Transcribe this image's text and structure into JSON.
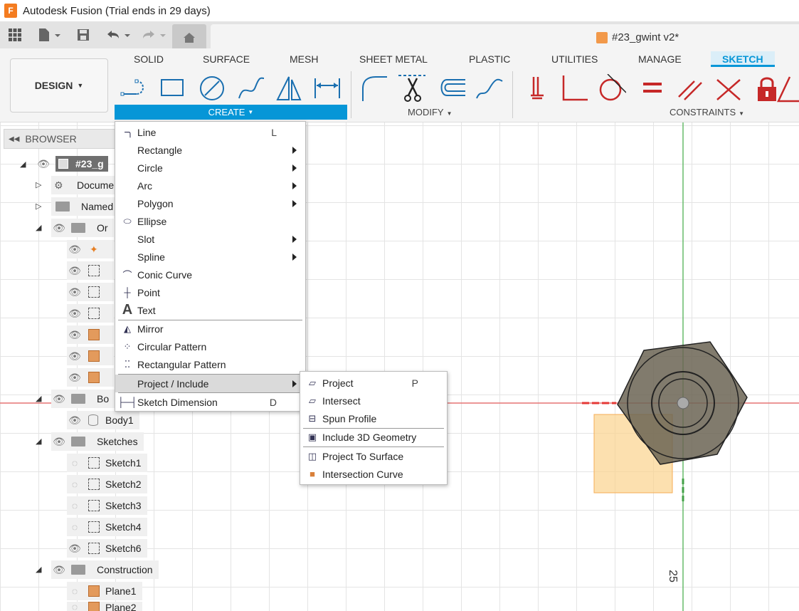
{
  "window": {
    "title": "Autodesk Fusion (Trial ends in 29 days)",
    "logo_text": "F"
  },
  "document": {
    "title": "#23_gwint v2*"
  },
  "workspace": {
    "label": "DESIGN"
  },
  "tabs": [
    "SOLID",
    "SURFACE",
    "MESH",
    "SHEET METAL",
    "PLASTIC",
    "UTILITIES",
    "MANAGE",
    "SKETCH"
  ],
  "active_tab": "SKETCH",
  "groups": {
    "create": "CREATE",
    "modify": "MODIFY",
    "constraints": "CONSTRAINTS"
  },
  "browser": {
    "title": "BROWSER",
    "root": "#23_g",
    "items": {
      "document_settings": "Docume",
      "named_views": "Named",
      "origin": "Or",
      "bodies": "Bo",
      "body1": "Body1",
      "sketches": "Sketches",
      "sketch1": "Sketch1",
      "sketch2": "Sketch2",
      "sketch3": "Sketch3",
      "sketch4": "Sketch4",
      "sketch6": "Sketch6",
      "construction": "Construction",
      "plane1": "Plane1",
      "plane2": "Plane2"
    }
  },
  "create_menu": {
    "line": "Line",
    "line_key": "L",
    "rectangle": "Rectangle",
    "circle": "Circle",
    "arc": "Arc",
    "polygon": "Polygon",
    "ellipse": "Ellipse",
    "slot": "Slot",
    "spline": "Spline",
    "conic_curve": "Conic Curve",
    "point": "Point",
    "text": "Text",
    "mirror": "Mirror",
    "circular_pattern": "Circular Pattern",
    "rectangular_pattern": "Rectangular Pattern",
    "project_include": "Project / Include",
    "sketch_dimension": "Sketch Dimension",
    "sketch_dimension_key": "D"
  },
  "project_submenu": {
    "project": "Project",
    "project_key": "P",
    "intersect": "Intersect",
    "spun_profile": "Spun Profile",
    "include_3d_geometry": "Include 3D Geometry",
    "project_to_surface": "Project To Surface",
    "intersection_curve": "Intersection Curve"
  },
  "canvas": {
    "dimension_label": "25"
  },
  "colors": {
    "accent": "#0696d7",
    "constraint_red": "#d32f2f",
    "plane_orange": "#e39a5c"
  }
}
